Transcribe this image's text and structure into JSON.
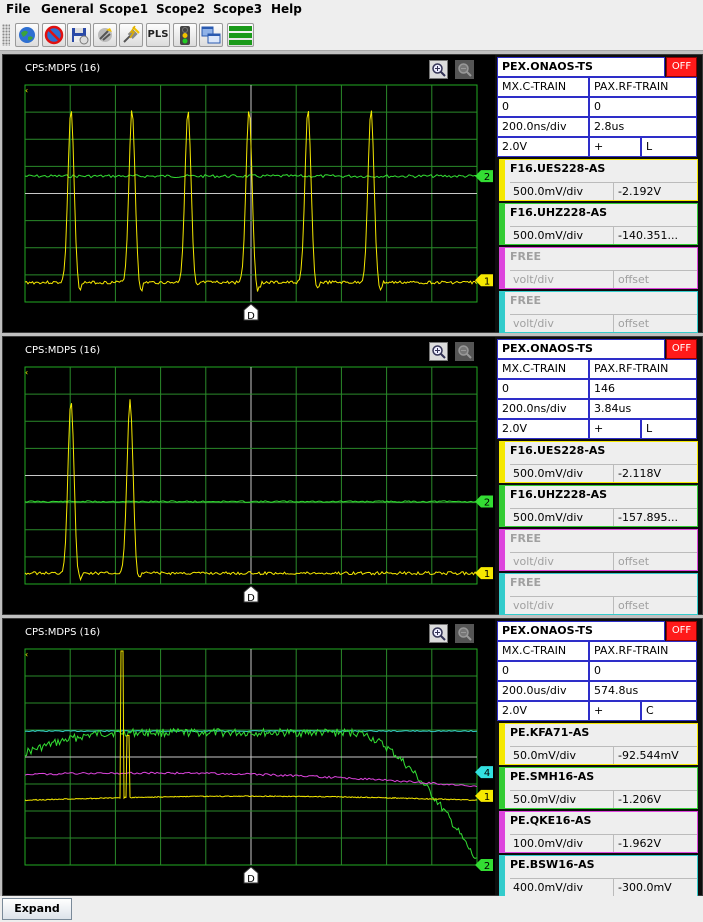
{
  "menu": [
    "File",
    "General",
    "Scope1",
    "Scope2",
    "Scope3",
    "Help"
  ],
  "toolbar": {
    "buttons": [
      "globe-icon",
      "no-globe-icon",
      "save-icon",
      "connect-icon",
      "plug-icon",
      "pls-button",
      "traffic-light-icon",
      "windows-icon",
      "layout-icon"
    ],
    "pls_label": "PLS"
  },
  "scopes": [
    {
      "title": "CPS:MDPS (16)",
      "header": {
        "name": "PEX.ONAOS-TS",
        "off": "OFF"
      },
      "trigger": {
        "label_a": "MX.C-TRAIN",
        "label_b": "PAX.RF-TRAIN",
        "value_a": "0",
        "value_b": "0"
      },
      "timebase": {
        "per_div": "200.0ns/div",
        "delay": "2.8us"
      },
      "trig": {
        "level": "2.0V",
        "slope": "+",
        "mode": "L"
      },
      "channels": [
        {
          "name": "F16.UES228-AS",
          "volt": "500.0mV/div",
          "offset": "-2.192V",
          "color": "#f5e800",
          "free": false
        },
        {
          "name": "F16.UHZ228-AS",
          "volt": "500.0mV/div",
          "offset": "-140.351...",
          "color": "#33cc33",
          "free": false
        },
        {
          "name": "FREE",
          "volt": "volt/div",
          "offset": "offset",
          "color": "#dd44dd",
          "free": true
        },
        {
          "name": "FREE",
          "volt": "volt/div",
          "offset": "offset",
          "color": "#33cccc",
          "free": true
        }
      ],
      "markers": [
        {
          "label": "2",
          "color": "#33dd33",
          "level": 0.42
        },
        {
          "label": "1",
          "color": "#f5e800",
          "level": 0.9
        }
      ],
      "trigger_marker": "D"
    },
    {
      "title": "CPS:MDPS (16)",
      "header": {
        "name": "PEX.ONAOS-TS",
        "off": "OFF"
      },
      "trigger": {
        "label_a": "MX.C-TRAIN",
        "label_b": "PAX.RF-TRAIN",
        "value_a": "0",
        "value_b": "146"
      },
      "timebase": {
        "per_div": "200.0ns/div",
        "delay": "3.84us"
      },
      "trig": {
        "level": "2.0V",
        "slope": "+",
        "mode": "L"
      },
      "channels": [
        {
          "name": "F16.UES228-AS",
          "volt": "500.0mV/div",
          "offset": "-2.118V",
          "color": "#f5e800",
          "free": false
        },
        {
          "name": "F16.UHZ228-AS",
          "volt": "500.0mV/div",
          "offset": "-157.895...",
          "color": "#33cc33",
          "free": false
        },
        {
          "name": "FREE",
          "volt": "volt/div",
          "offset": "offset",
          "color": "#dd44dd",
          "free": true
        },
        {
          "name": "FREE",
          "volt": "volt/div",
          "offset": "offset",
          "color": "#33cccc",
          "free": true
        }
      ],
      "markers": [
        {
          "label": "2",
          "color": "#33dd33",
          "level": 0.62
        },
        {
          "label": "1",
          "color": "#f5e800",
          "level": 0.95
        }
      ],
      "trigger_marker": "D"
    },
    {
      "title": "CPS:MDPS (16)",
      "header": {
        "name": "PEX.ONAOS-TS",
        "off": "OFF"
      },
      "trigger": {
        "label_a": "MX.C-TRAIN",
        "label_b": "PAX.RF-TRAIN",
        "value_a": "0",
        "value_b": "0"
      },
      "timebase": {
        "per_div": "200.0us/div",
        "delay": "574.8us"
      },
      "trig": {
        "level": "2.0V",
        "slope": "+",
        "mode": "C"
      },
      "channels": [
        {
          "name": "PE.KFA71-AS",
          "volt": "50.0mV/div",
          "offset": "-92.544mV",
          "color": "#f5e800",
          "free": false
        },
        {
          "name": "PE.SMH16-AS",
          "volt": "50.0mV/div",
          "offset": "-1.206V",
          "color": "#33cc33",
          "free": false
        },
        {
          "name": "PE.QKE16-AS",
          "volt": "100.0mV/div",
          "offset": "-1.962V",
          "color": "#dd44dd",
          "free": false
        },
        {
          "name": "PE.BSW16-AS",
          "volt": "400.0mV/div",
          "offset": "-300.0mV",
          "color": "#33cccc",
          "free": false
        }
      ],
      "markers": [
        {
          "label": "4",
          "color": "#33e0e0",
          "level": 0.57
        },
        {
          "label": "1",
          "color": "#f5e800",
          "level": 0.68
        },
        {
          "label": "2",
          "color": "#33dd33",
          "level": 1.0
        }
      ],
      "trigger_marker": "D"
    }
  ],
  "bottom": {
    "expand_label": "Expand"
  }
}
